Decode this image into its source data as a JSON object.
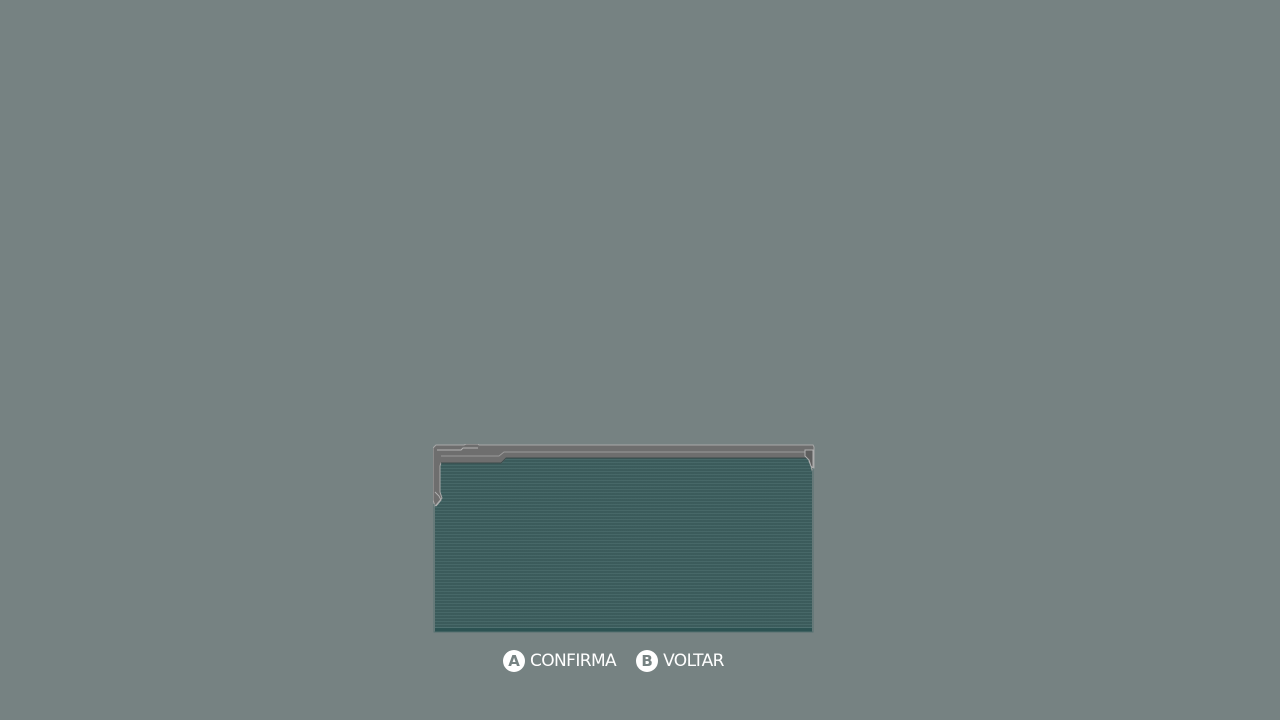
{
  "prompts": [
    {
      "button": "A",
      "label": "CONFIRMA",
      "button_icon": "a-button-icon"
    },
    {
      "button": "B",
      "label": "VOLTAR",
      "button_icon": "b-button-icon"
    }
  ],
  "colors": {
    "background": "#768282",
    "panel_fill": "#3f6161",
    "frame": "#8a8a8a",
    "prompt_text": "#ffffff"
  }
}
